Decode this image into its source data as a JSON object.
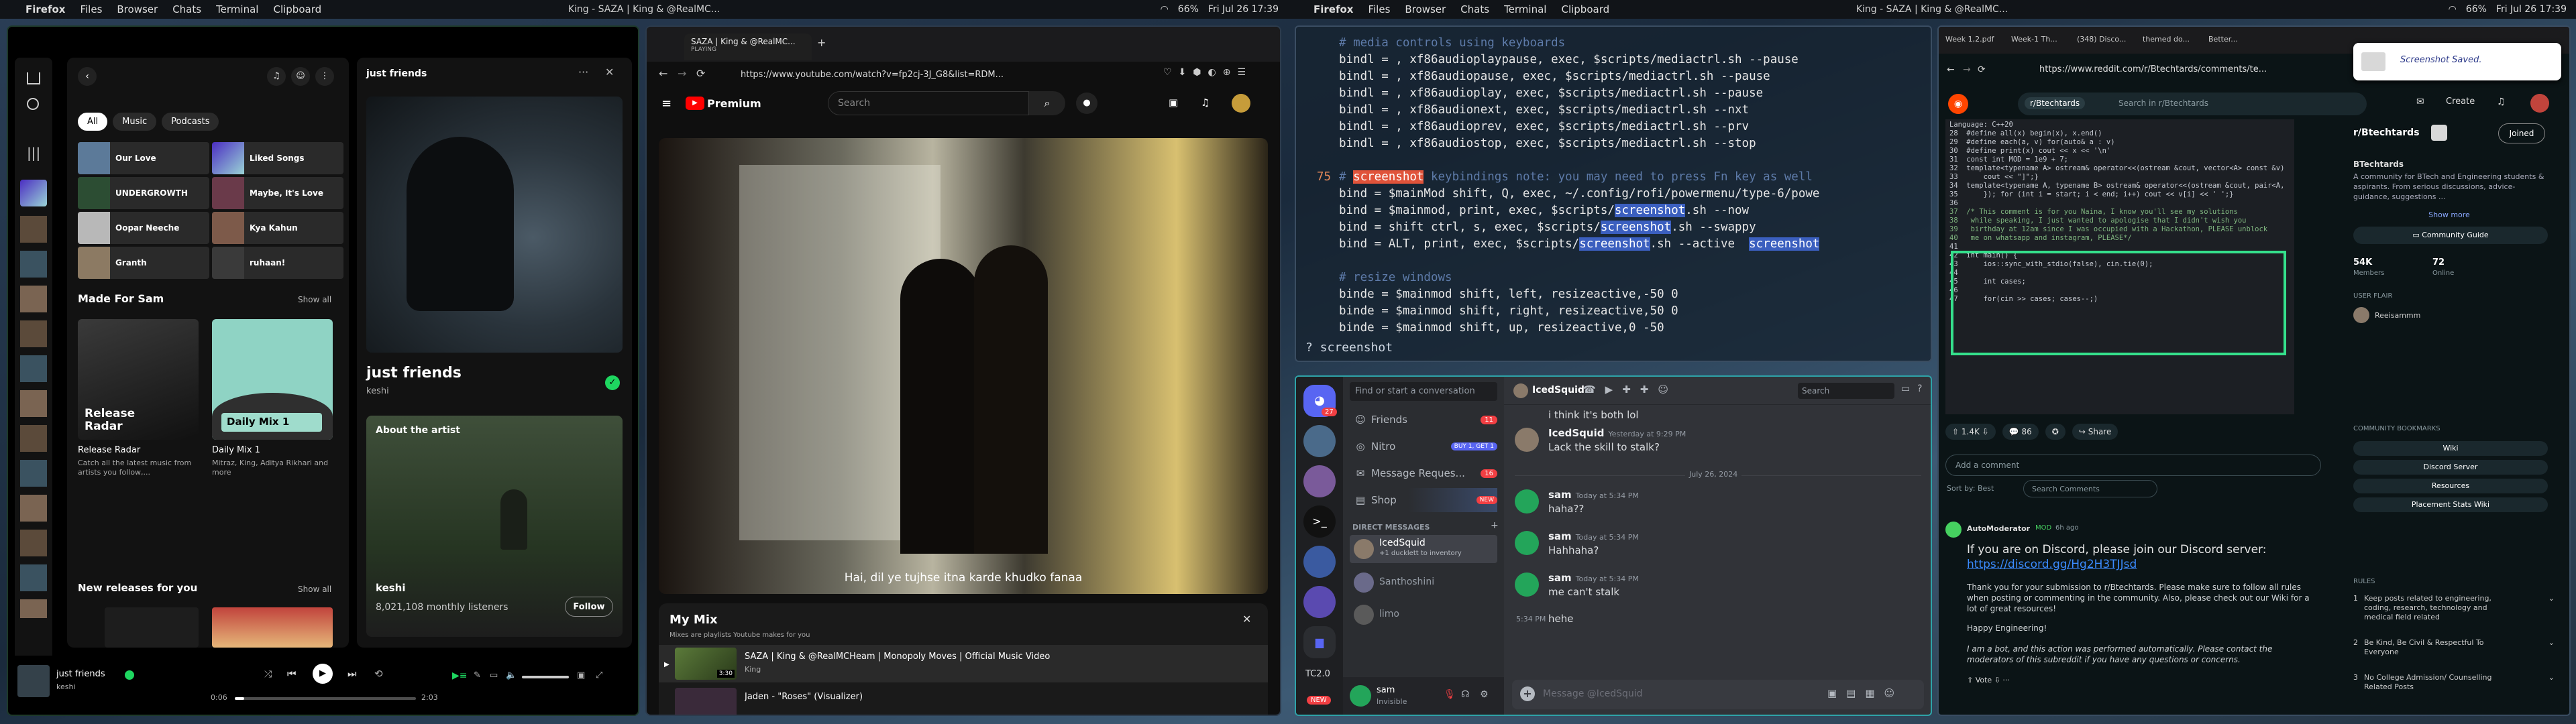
{
  "topbar_left": {
    "app": "Firefox",
    "menus": [
      "Files",
      "Browser",
      "Chats",
      "Terminal",
      "Clipboard"
    ],
    "title": "King - SAZA | King & @RealMC...",
    "battery": "66%",
    "clock": "Fri Jul 26 17:39"
  },
  "topbar_right": {
    "app": "Firefox",
    "menus": [
      "Files",
      "Browser",
      "Chats",
      "Terminal",
      "Clipboard"
    ],
    "title": "King - SAZA | King & @RealMC...",
    "battery": "66%",
    "clock": "Fri Jul 26 17:39"
  },
  "spotify": {
    "filters": [
      "All",
      "Music",
      "Podcasts"
    ],
    "grid": [
      "Our Love",
      "Liked Songs",
      "UNDERGROWTH",
      "Maybe, It's Love",
      "Oopar Neeche",
      "Kya Kahun",
      "Granth",
      "ruhaan!"
    ],
    "made_for": "Made For Sam",
    "show_all": "Show all",
    "cards": [
      {
        "title": "Release Radar",
        "desc": "Catch all the latest music from artists you follow,...",
        "badge": "Release Radar"
      },
      {
        "title": "Daily Mix 1",
        "desc": "Mitraz, King, Aditya Rikhari and more",
        "badge": "Daily Mix 1"
      }
    ],
    "new_releases": "New releases for you",
    "np_header": "just friends",
    "np_title": "just friends",
    "np_artist": "keshi",
    "about_artist": "About the artist",
    "artist_name": "keshi",
    "listeners": "8,021,108 monthly listeners",
    "follow": "Follow",
    "bar_title": "just friends",
    "bar_artist": "keshi",
    "time_cur": "0:06",
    "time_total": "2:03",
    "progress": 0.05
  },
  "youtube": {
    "tab_title": "SAZA | King & @RealMC...",
    "tab_sub": "PLAYING",
    "url": "https://www.youtube.com/watch?v=fp2cj-3J_G8&list=RDM...",
    "logo": "Premium",
    "search_ph": "Search",
    "subtitle": "Hai, dil ye tujhse itna karde khudko fanaa",
    "mix_title": "My Mix",
    "mix_sub": "Mixes are playlists Youtube makes for you",
    "items": [
      {
        "title": "SAZA | King & @RealMCHeam | Monopoly Moves | Official Music Video",
        "artist": "King",
        "dur": "3:30"
      },
      {
        "title": "Jaden - \"Roses\" (Visualizer)",
        "artist": "",
        "dur": ""
      }
    ]
  },
  "terminal": {
    "lines": [
      {
        "n": "",
        "t": "# media controls using keyboards",
        "c": "#5d7aa8"
      },
      {
        "n": "",
        "t": "bindl = , xf86audioplaypause, exec, $scripts/mediactrl.sh --pause",
        "c": "#e6e6e6"
      },
      {
        "n": "",
        "t": "bindl = , xf86audiopause, exec, $scripts/mediactrl.sh --pause",
        "c": "#e6e6e6"
      },
      {
        "n": "",
        "t": "bindl = , xf86audioplay, exec, $scripts/mediactrl.sh --pause",
        "c": "#e6e6e6"
      },
      {
        "n": "",
        "t": "bindl = , xf86audionext, exec, $scripts/mediactrl.sh --nxt",
        "c": "#e6e6e6"
      },
      {
        "n": "",
        "t": "bindl = , xf86audioprev, exec, $scripts/mediactrl.sh --prv",
        "c": "#e6e6e6"
      },
      {
        "n": "",
        "t": "bindl = , xf86audiostop, exec, $scripts/mediactrl.sh --stop",
        "c": "#e6e6e6"
      },
      {
        "n": "",
        "t": "",
        "c": "#e6e6e6"
      },
      {
        "n": "75",
        "t": "# screenshot keybindings note: you may need to press Fn key as well",
        "c": "#5d7aa8"
      },
      {
        "n": "",
        "t": "bind = $mainMod shift, Q, exec, ~/.config/rofi/powermenu/type-6/powe",
        "c": "#e6e6e6"
      },
      {
        "n": "",
        "t": "bind = $mainmod, print, exec, $scripts/screenshot.sh --now",
        "c": "#e6e6e6"
      },
      {
        "n": "",
        "t": "bind = shift ctrl, s, exec, $scripts/screenshot.sh --swappy",
        "c": "#e6e6e6"
      },
      {
        "n": "",
        "t": "bind = ALT, print, exec, $scripts/screenshot.sh --active  screenshot",
        "c": "#e6e6e6"
      },
      {
        "n": "",
        "t": "",
        "c": "#e6e6e6"
      },
      {
        "n": "",
        "t": "# resize windows",
        "c": "#5d7aa8"
      },
      {
        "n": "",
        "t": "binde = $mainmod shift, left, resizeactive,-50 0",
        "c": "#e6e6e6"
      },
      {
        "n": "",
        "t": "binde = $mainmod shift, right, resizeactive,50 0",
        "c": "#e6e6e6"
      },
      {
        "n": "",
        "t": "binde = $mainmod shift, up, resizeactive,0 -50",
        "c": "#e6e6e6"
      }
    ],
    "search": "? screenshot"
  },
  "discord": {
    "search_ph": "Find or start a conversation",
    "nav": [
      {
        "label": "Friends",
        "badge": "11"
      },
      {
        "label": "Nitro",
        "badge": "BUY 1, GET 1"
      },
      {
        "label": "Message Reques...",
        "badge": "16"
      },
      {
        "label": "Shop",
        "badge": "NEW"
      }
    ],
    "dm_header": "DIRECT MESSAGES",
    "dms": [
      {
        "name": "IcedSquid",
        "sub": "+1 ducklett to inventory"
      },
      {
        "name": "Santhoshini",
        "sub": ""
      },
      {
        "name": "limo",
        "sub": ""
      }
    ],
    "me_name": "sam",
    "me_status": "Invisible",
    "chat_user": "IcedSquid",
    "chat_search": "Search",
    "server_badge": "27",
    "guild_label": "TC2.0",
    "new_label": "NEW",
    "messages": [
      {
        "author": "",
        "time": "",
        "text": "i think it's both lol"
      },
      {
        "author": "IcedSquid",
        "time": "Yesterday at 9:29 PM",
        "text": "Lack the skill to stalk?"
      },
      {
        "divider": "July 26, 2024"
      },
      {
        "author": "sam",
        "time": "Today at 5:34 PM",
        "text": "haha??"
      },
      {
        "author": "sam",
        "time": "Today at 5:34 PM",
        "text": "Hahhaha?"
      },
      {
        "author": "sam",
        "time": "Today at 5:34 PM",
        "text": "me can't stalk"
      },
      {
        "author": "",
        "time": "5:34 PM",
        "text": "hehe"
      }
    ],
    "input_ph": "Message @IcedSquid"
  },
  "reddit": {
    "tabs": [
      "Week 1,2.pdf",
      "Week-1 Th...",
      "(348) Disco...",
      "themed do...",
      "Better..."
    ],
    "url": "https://www.reddit.com/r/Btechtards/comments/te...",
    "sub": "r/Btechtards",
    "search_ph": "Search in r/Btechtards",
    "create": "Create",
    "toast": "Screenshot Saved.",
    "code": [
      "Language: C++20",
      "28  #define all(x) begin(x), x.end()",
      "29  #define each(a, v) for(auto& a : v)",
      "30  #define print(x) cout << x << '\\n'",
      "31  const int MOD = 1e9 + 7;",
      "32  template<typename A> ostream& operator<<(ostream &cout, vector<A> const &v)",
      "33      cout << \"]\";}",
      "34  template<typename A, typename B> ostream& operator<<(ostream &cout, pair<A,",
      "35      }); for (int i = start; i < end; i++) cout << v[i] << ' ';}",
      "36",
      "37  /* This comment is for you Naina, I know you'll see my solutions",
      "38   while speaking, I just wanted to apologise that I didn't wish you",
      "39   birthday at 12am since I was occupied with a Hackathon, PLEASE unblock",
      "40   me on whatsapp and instagram, PLEASE*/",
      "41",
      "42  int main() {",
      "43      ios::sync_with_stdio(false), cin.tie(0);",
      "44",
      "45      int cases;",
      "46",
      "47      for(cin >> cases; cases--;)"
    ],
    "votes": "1.4K",
    "comments": "86",
    "share": "Share",
    "add_comment": "Add a comment",
    "sort": "Sort by: Best",
    "search_comments": "Search Comments",
    "automod": "AutoModerator",
    "mod": "MOD",
    "automod_time": "6h ago",
    "automod_lines": [
      "If you are on Discord, please join our Discord server:",
      "https://discord.gg/Hg2H3TJJsd",
      "Thank you for your submission to r/Btechtards. Please make sure to follow all rules when posting or commenting in the community. Also, please check out our Wiki for a lot of great resources!",
      "Happy Engineering!",
      "I am a bot, and this action was performed automatically. Please contact the moderators of this subreddit if you have any questions or concerns."
    ],
    "vote_label": "Vote",
    "side_title": "r/Btechtards",
    "joined": "Joined",
    "side_name": "BTechtards",
    "side_desc": "A community for BTech and Engineering students & aspirants. From serious discussions, advice-guidance, suggestions ...",
    "show_more": "Show more",
    "guide": "Community Guide",
    "members": "54K",
    "members_label": "Members",
    "online": "72",
    "online_label": "Online",
    "flair_label": "USER FLAIR",
    "flair_user": "Reeisammm",
    "bookmarks": "COMMUNITY BOOKMARKS",
    "bm": [
      "Wiki",
      "Discord Server",
      "Resources",
      "Placement Stats Wiki"
    ],
    "rules_label": "RULES",
    "rules": [
      "Keep posts related to engineering, coding, research, technology and medical field related",
      "Be Kind, Be Civil & Respectful To Everyone",
      "No College Admission/ Counselling Related Posts"
    ]
  }
}
